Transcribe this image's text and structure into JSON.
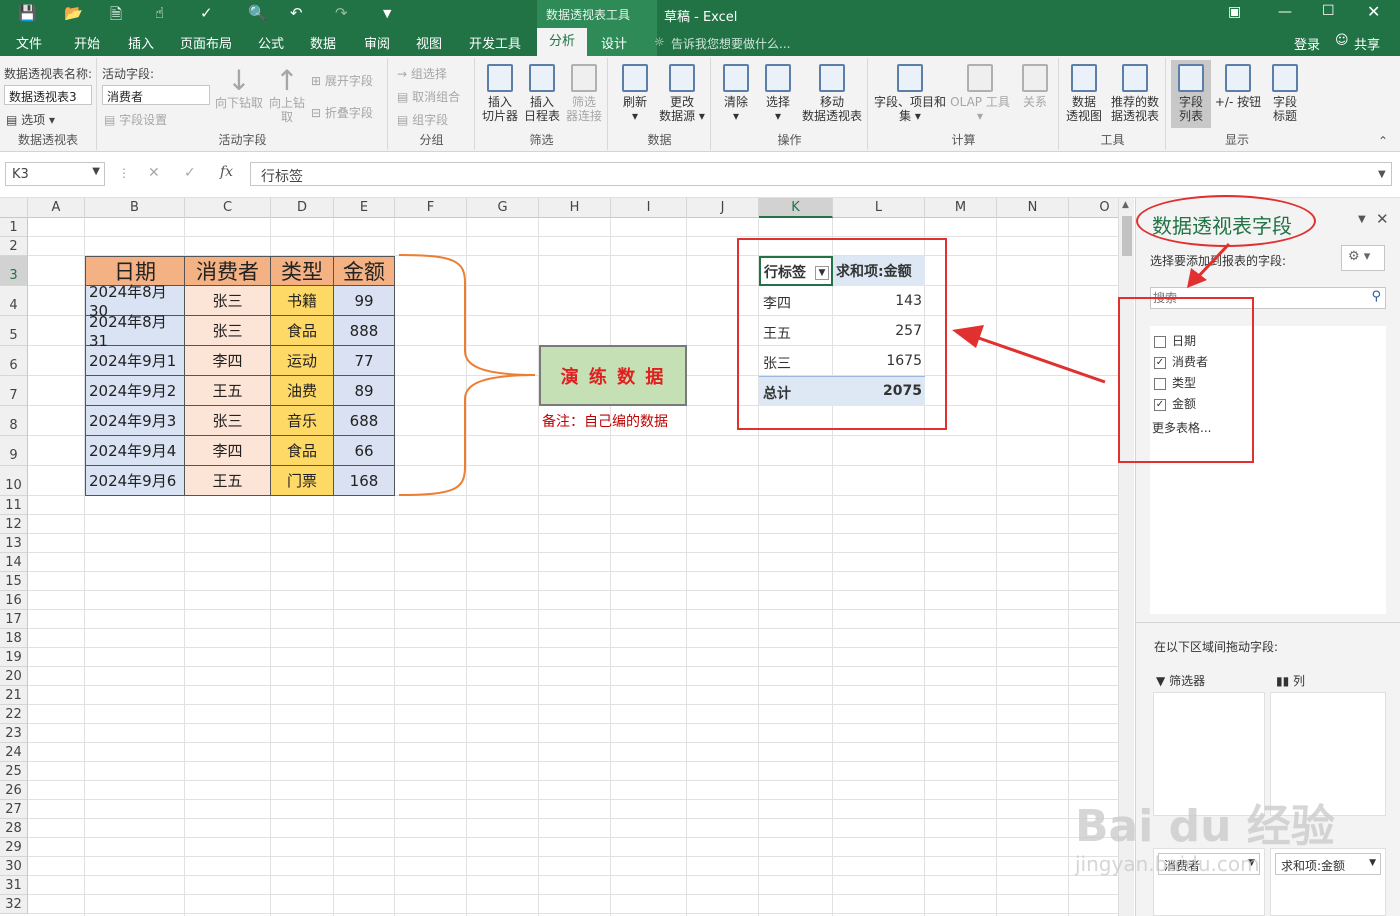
{
  "window": {
    "context_tab_group": "数据透视表工具",
    "doc_title": "草稿 - Excel",
    "login": "登录",
    "share": "共享"
  },
  "tabs": [
    "文件",
    "开始",
    "插入",
    "页面布局",
    "公式",
    "数据",
    "审阅",
    "视图",
    "开发工具",
    "分析",
    "设计"
  ],
  "tell_me": "告诉我您想要做什么...",
  "ribbon": {
    "pivot_name_label": "数据透视表名称:",
    "pivot_name_value": "数据透视表3",
    "options": "选项",
    "group_pivot": "数据透视表",
    "active_field_label": "活动字段:",
    "active_field_value": "消费者",
    "field_settings": "字段设置",
    "drill_down": "向下钻取",
    "drill_up_1": "向上钻",
    "drill_up_2": "取",
    "expand_field": "展开字段",
    "collapse_field": "折叠字段",
    "group_active_field": "活动字段",
    "group_selection": "组选择",
    "ungroup": "取消组合",
    "group_field": "组字段",
    "group_group": "分组",
    "insert_slicer_1": "插入",
    "insert_slicer_2": "切片器",
    "insert_timeline_1": "插入",
    "insert_timeline_2": "日程表",
    "filter_conn_1": "筛选",
    "filter_conn_2": "器连接",
    "group_filter": "筛选",
    "refresh": "刷新",
    "change_source_1": "更改",
    "change_source_2": "数据源",
    "group_data": "数据",
    "clear": "清除",
    "select": "选择",
    "move_1": "移动",
    "move_2": "数据透视表",
    "group_actions": "操作",
    "fields_items_1": "字段、项目和",
    "fields_items_2": "集",
    "olap": "OLAP 工具",
    "relations": "关系",
    "group_calc": "计算",
    "pivot_chart_1": "数据",
    "pivot_chart_2": "透视图",
    "recommended_1": "推荐的数",
    "recommended_2": "据透视表",
    "group_tools": "工具",
    "field_list_1": "字段",
    "field_list_2": "列表",
    "buttons": "+/- 按钮",
    "field_headers_1": "字段",
    "field_headers_2": "标题",
    "group_show": "显示"
  },
  "formula_bar": {
    "name_box": "K3",
    "content": "行标签"
  },
  "columns": [
    "A",
    "B",
    "C",
    "D",
    "E",
    "F",
    "G",
    "H",
    "I",
    "J",
    "K",
    "L",
    "M",
    "N",
    "O"
  ],
  "rows": [
    "1",
    "2",
    "3",
    "4",
    "5",
    "6",
    "7",
    "8",
    "9",
    "10",
    "11",
    "12",
    "13",
    "14",
    "15",
    "16",
    "17",
    "18",
    "19",
    "20",
    "21",
    "22",
    "23",
    "24",
    "25",
    "26",
    "27",
    "28",
    "29",
    "30",
    "31",
    "32"
  ],
  "source_table": {
    "headers": [
      "日期",
      "消费者",
      "类型",
      "金额"
    ],
    "rows": [
      [
        "2024年8月30",
        "张三",
        "书籍",
        "99"
      ],
      [
        "2024年8月31",
        "张三",
        "食品",
        "888"
      ],
      [
        "2024年9月1",
        "李四",
        "运动",
        "77"
      ],
      [
        "2024年9月2",
        "王五",
        "油费",
        "89"
      ],
      [
        "2024年9月3",
        "张三",
        "音乐",
        "688"
      ],
      [
        "2024年9月4",
        "李四",
        "食品",
        "66"
      ],
      [
        "2024年9月6",
        "王五",
        "门票",
        "168"
      ]
    ]
  },
  "practice_box": {
    "title": "演 练 数 据",
    "note": "备注：自己编的数据"
  },
  "pivot": {
    "row_label": "行标签",
    "sum_label": "求和项:金额",
    "rows": [
      [
        "李四",
        "143"
      ],
      [
        "王五",
        "257"
      ],
      [
        "张三",
        "1675"
      ]
    ],
    "total_label": "总计",
    "total_value": "2075"
  },
  "field_pane": {
    "title": "数据透视表字段",
    "choose_label": "选择要添加到报表的字段:",
    "search_placeholder": "搜索",
    "fields": [
      {
        "name": "日期",
        "checked": false
      },
      {
        "name": "消费者",
        "checked": true
      },
      {
        "name": "类型",
        "checked": false
      },
      {
        "name": "金额",
        "checked": true
      }
    ],
    "more_tables": "更多表格...",
    "drag_label": "在以下区域间拖动字段:",
    "filters": "筛选器",
    "columns": "列",
    "rows_value": "消费者",
    "values_value": "求和项:金额"
  },
  "watermark": {
    "text": "Bai du 经验",
    "url": "jingyan.baidu.com"
  },
  "colors": {
    "excel_green": "#217346",
    "header_orange": "#f4b183",
    "date_blue": "#dae3f3",
    "consumer_peach": "#fce4d6",
    "type_yellow": "#ffd966",
    "amount_blue": "#d9e1f2",
    "annotation_red": "#e03030"
  }
}
